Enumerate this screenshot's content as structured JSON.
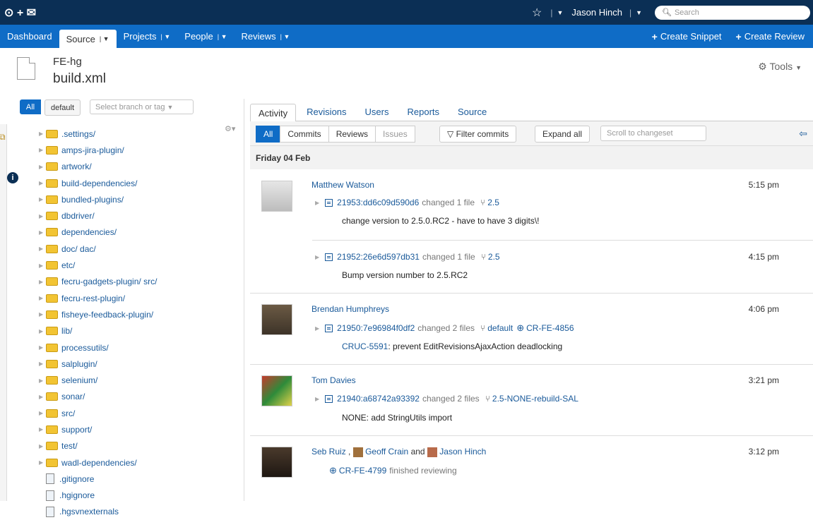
{
  "topbar": {
    "logo": "⊙ + ✉",
    "user": "Jason Hinch",
    "search_placeholder": "Search"
  },
  "nav": {
    "items": [
      {
        "label": "Dashboard"
      },
      {
        "label": "Source"
      },
      {
        "label": "Projects"
      },
      {
        "label": "People"
      },
      {
        "label": "Reviews"
      }
    ],
    "create_snippet": "Create Snippet",
    "create_review": "Create Review"
  },
  "header": {
    "repo": "FE-hg",
    "file": "build.xml",
    "tools": "Tools"
  },
  "branch": {
    "all": "All",
    "default": "default",
    "placeholder": "Select branch or tag"
  },
  "tree": {
    "folders": [
      ".settings/",
      "amps-jira-plugin/",
      "artwork/",
      "build-dependencies/",
      "bundled-plugins/",
      "dbdriver/",
      "dependencies/",
      "doc/ dac/",
      "etc/",
      "fecru-gadgets-plugin/ src/",
      "fecru-rest-plugin/",
      "fisheye-feedback-plugin/",
      "lib/",
      "processutils/",
      "salplugin/",
      "selenium/",
      "sonar/",
      "src/",
      "support/",
      "test/",
      "wadl-dependencies/"
    ],
    "files": [
      ".gitignore",
      ".hgignore",
      ".hgsvnexternals"
    ]
  },
  "tabs": [
    "Activity",
    "Revisions",
    "Users",
    "Reports",
    "Source"
  ],
  "toolbar": {
    "all": "All",
    "commits": "Commits",
    "reviews": "Reviews",
    "issues": "Issues",
    "filter": "Filter commits",
    "expand": "Expand all",
    "scroll_placeholder": "Scroll to changeset"
  },
  "date_heading": "Friday 04 Feb",
  "entries": [
    {
      "author": "Matthew Watson",
      "time1": "5:15 pm",
      "cs1": "21953:dd6c09d590d6",
      "cs1_text": "changed 1 file",
      "cs1_branch": "2.5",
      "msg1": "change version to 2.5.0.RC2 - have to have 3 digits\\!",
      "time2": "4:15 pm",
      "cs2": "21952:26e6d597db31",
      "cs2_text": "changed 1 file",
      "cs2_branch": "2.5",
      "msg2": "Bump version number to 2.5.RC2"
    },
    {
      "author": "Brendan Humphreys",
      "time": "4:06 pm",
      "cs": "21950:7e96984f0df2",
      "cs_text": "changed 2 files",
      "branch": "default",
      "review": "CR-FE-4856",
      "msg_link": "CRUC-5591",
      "msg": ": prevent EditRevisionsAjaxAction deadlocking"
    },
    {
      "author": "Tom Davies",
      "time": "3:21 pm",
      "cs": "21940:a68742a93392",
      "cs_text": "changed 2 files",
      "branch": "2.5-NONE-rebuild-SAL",
      "msg": "NONE: add StringUtils import"
    },
    {
      "author1": "Seb Ruiz",
      "sep1": ",",
      "author2": "Geoff Crain",
      "and": "and",
      "author3": "Jason Hinch",
      "time": "3:12 pm",
      "review": "CR-FE-4799",
      "review_text": "finished reviewing"
    }
  ],
  "colors": {
    "topbar": "#0b2f55",
    "nav": "#0f6cc6",
    "link": "#1a5a9a"
  }
}
